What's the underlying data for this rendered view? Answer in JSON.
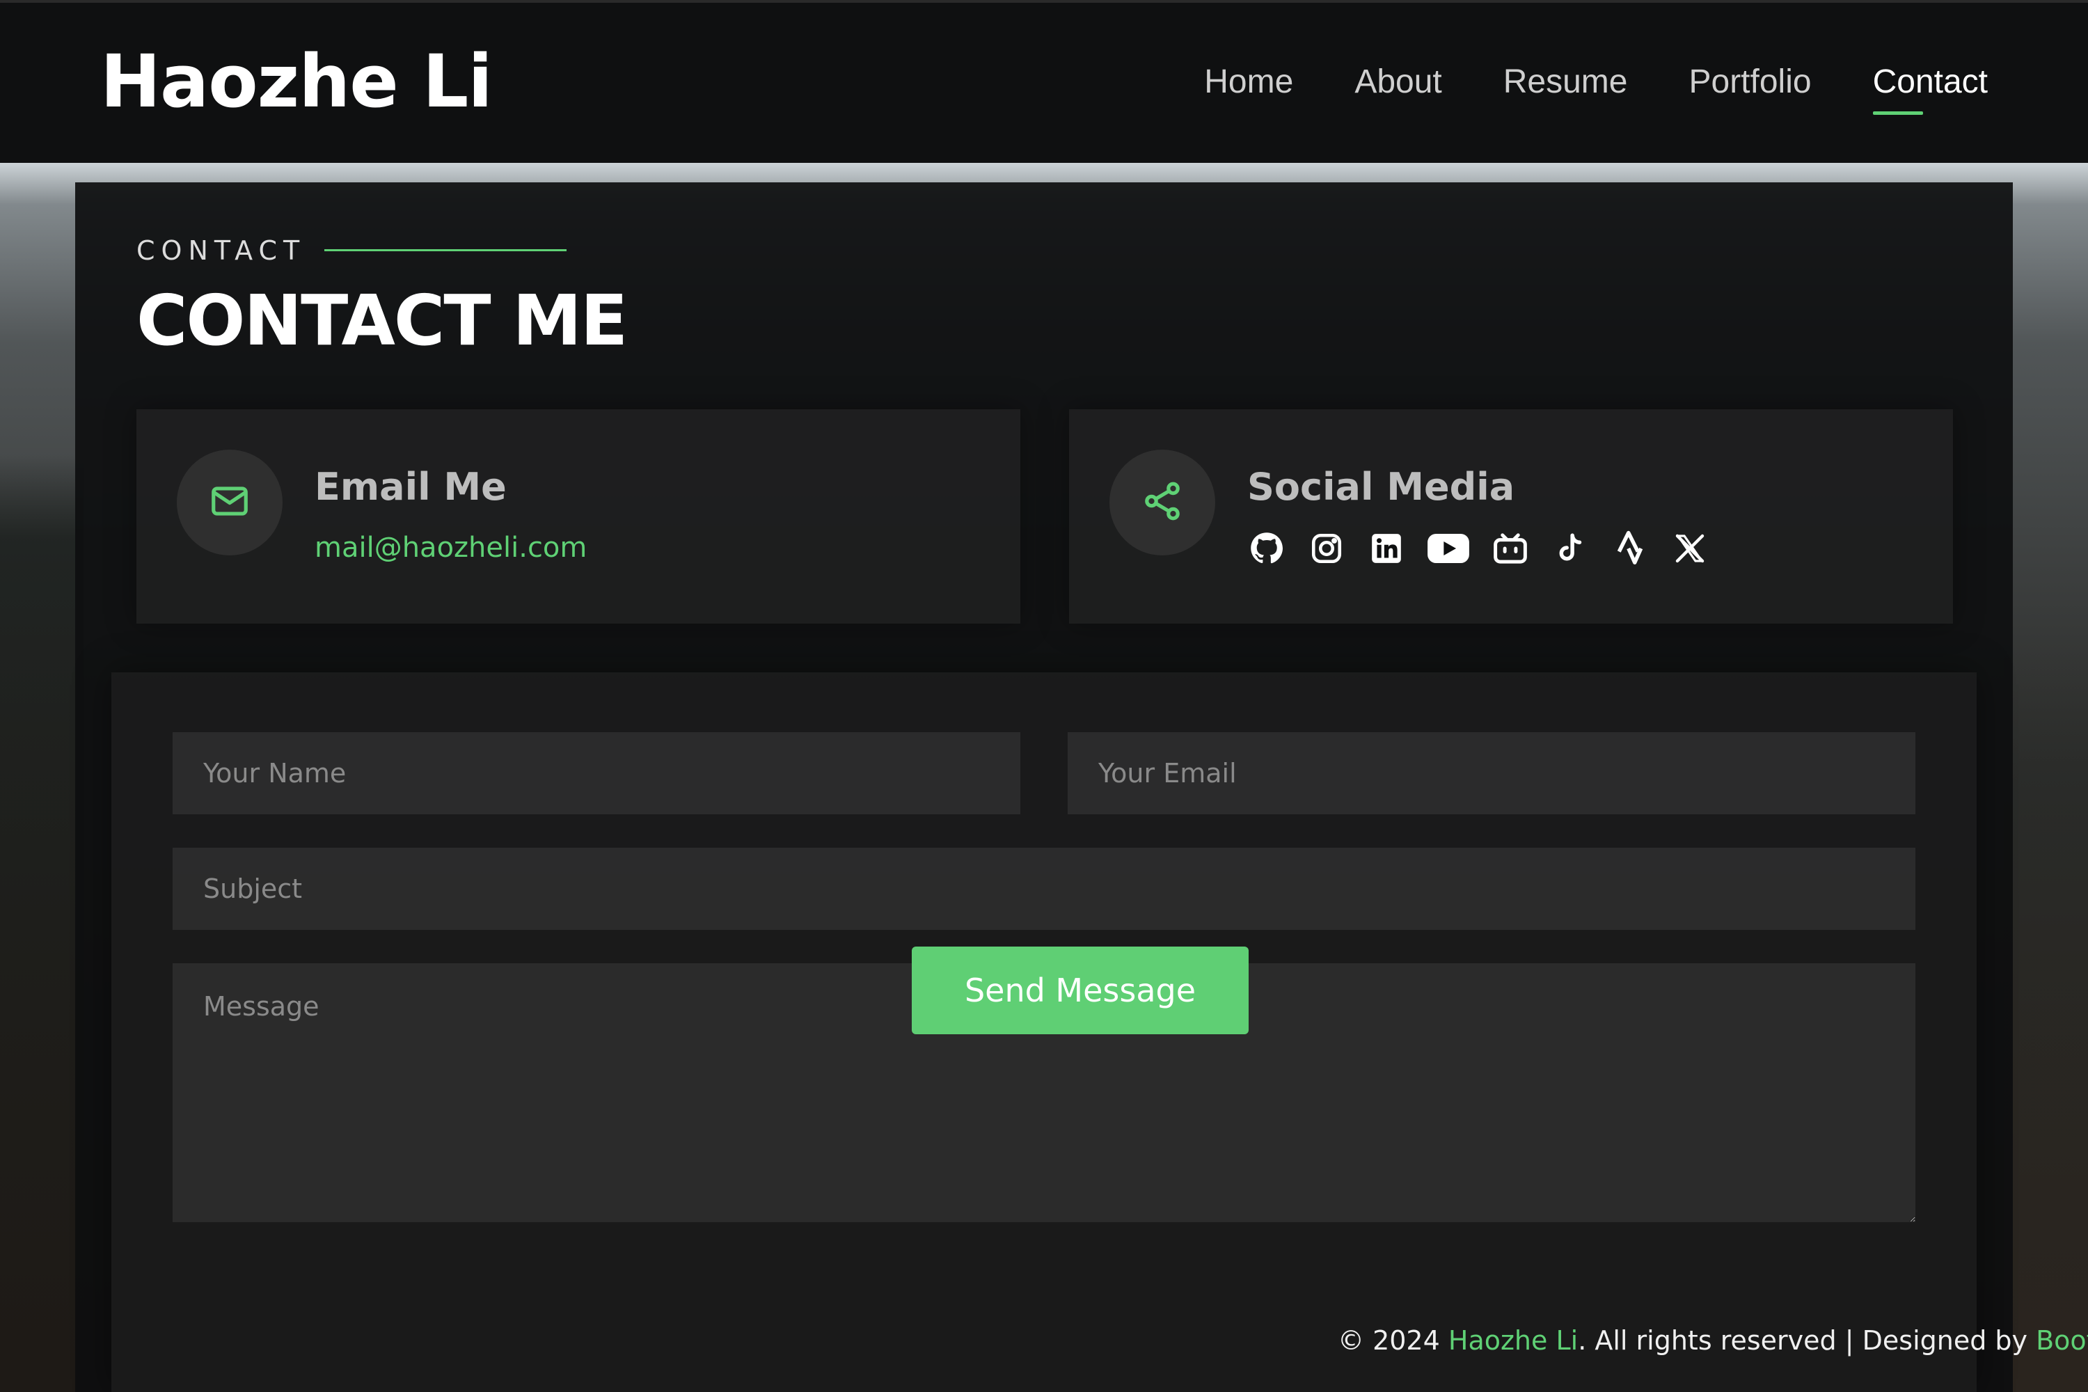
{
  "header": {
    "logo": "Haozhe Li",
    "nav": [
      "Home",
      "About",
      "Resume",
      "Portfolio",
      "Contact"
    ],
    "active_nav": "Contact"
  },
  "section": {
    "label": "CONTACT",
    "title": "CONTACT ME"
  },
  "email_card": {
    "title": "Email Me",
    "value": "mail@haozheli.com",
    "icon": "envelope-icon"
  },
  "social_card": {
    "title": "Social Media",
    "icon": "share-icon",
    "icons": [
      "github-icon",
      "instagram-icon",
      "linkedin-icon",
      "youtube-icon",
      "bilibili-icon",
      "tiktok-icon",
      "strava-icon",
      "x-icon"
    ]
  },
  "form": {
    "name_placeholder": "Your Name",
    "email_placeholder": "Your Email",
    "subject_placeholder": "Subject",
    "message_placeholder": "Message",
    "submit_label": "Send Message"
  },
  "footer": {
    "prefix": "© 2024 ",
    "owner": "Haozhe Li",
    "middle": ". All rights reserved | Designed by ",
    "designer": "Bootstrap"
  },
  "colors": {
    "accent": "#5fd175",
    "background": "#0e0f10"
  }
}
